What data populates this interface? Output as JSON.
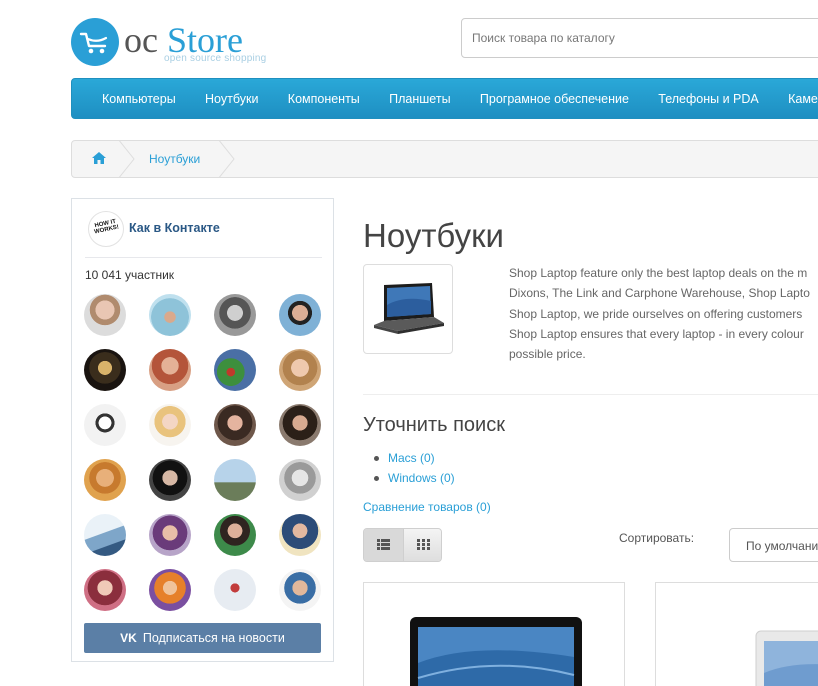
{
  "brand": {
    "logo_oc": "oc",
    "logo_store": "Store",
    "logo_sub": "open source shopping"
  },
  "search": {
    "placeholder": "Поиск товара по каталогу"
  },
  "menu": {
    "items": [
      "Компьютеры",
      "Ноутбуки",
      "Компоненты",
      "Планшеты",
      "Програмное обеспечение",
      "Телефоны и PDA",
      "Камеры"
    ]
  },
  "breadcrumb": {
    "home_icon": "home-icon",
    "current": "Ноутбуки"
  },
  "vk_widget": {
    "group_name": "Как в Контакте",
    "avatar_text": "HOW IT WORKS!",
    "members_count": "10 041 участник",
    "subscribe_label": "Подписаться на новости",
    "vk_logo": "VK"
  },
  "category": {
    "title": "Ноутбуки",
    "description_lines": [
      "Shop Laptop feature only the best laptop deals on the m",
      "Dixons, The Link and Carphone Warehouse, Shop Lapto",
      "Shop Laptop, we pride ourselves on offering customers",
      "Shop Laptop ensures that every laptop - in every colour",
      "possible price."
    ]
  },
  "refine": {
    "title": "Уточнить поиск",
    "items": [
      "Macs (0)",
      "Windows (0)"
    ]
  },
  "compare_link": "Сравнение товаров (0)",
  "view": {
    "list_icon": "list-view-icon",
    "grid_icon": "grid-view-icon"
  },
  "sort": {
    "label": "Сортировать:",
    "selected": "По умолчанию"
  },
  "colors": {
    "accent": "#2a9fd6",
    "vk_blue": "#5b7fa6",
    "vk_link": "#2a5885"
  }
}
